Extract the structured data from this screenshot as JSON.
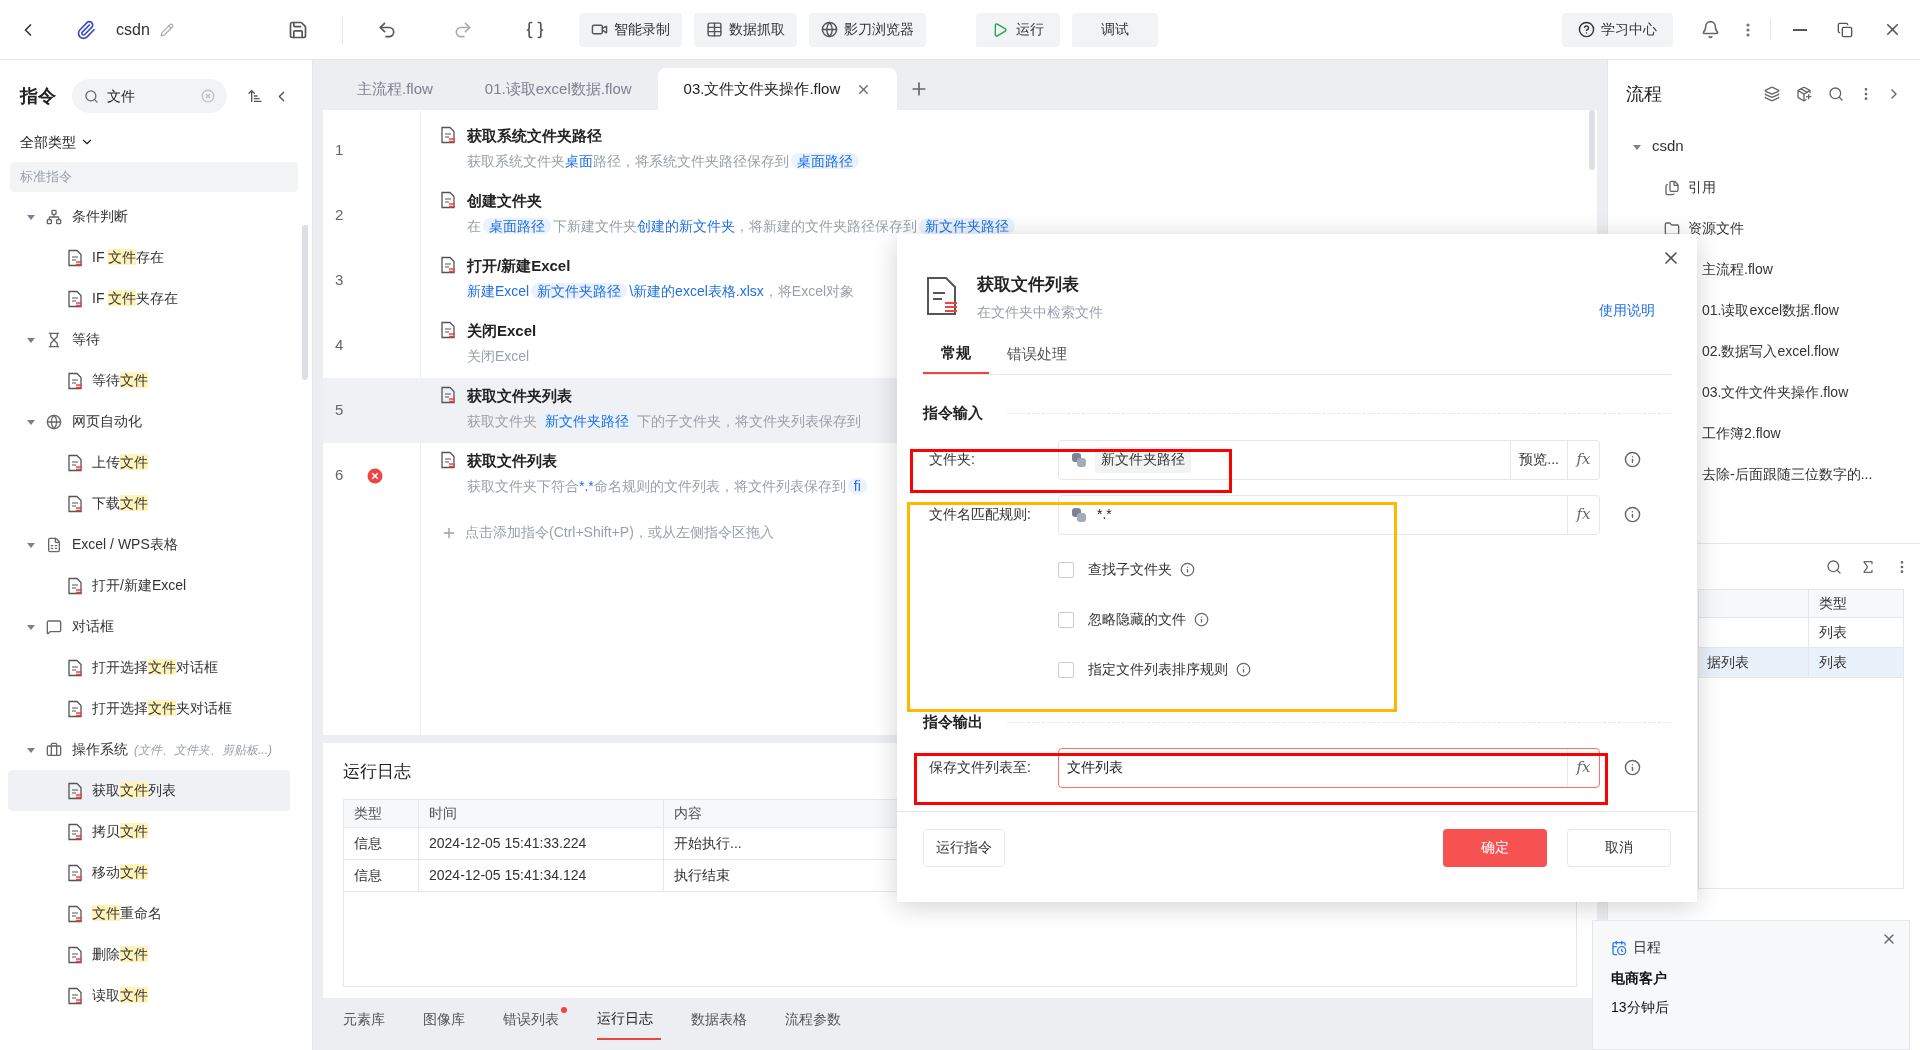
{
  "top_bar": {
    "project": "csdn",
    "tools": [
      {
        "label": "智能录制"
      },
      {
        "label": "数据抓取"
      },
      {
        "label": "影刀浏览器"
      }
    ],
    "run": "运行",
    "debug": "调试",
    "help": "学习中心"
  },
  "sidebar": {
    "title": "指令",
    "search": {
      "value": "文件"
    },
    "filter": "全部类型",
    "section": "标准指令",
    "categories": [
      {
        "label": "条件判断",
        "expanded": true,
        "children": [
          {
            "parts": [
              {
                "text": "IF "
              },
              {
                "text": "文件",
                "highlight": true
              },
              {
                "text": "存在"
              }
            ],
            "selected": false
          },
          {
            "parts": [
              {
                "text": "IF "
              },
              {
                "text": "文件",
                "highlight": true
              },
              {
                "text": "夹存在"
              }
            ],
            "selected": false
          }
        ]
      },
      {
        "label": "等待",
        "expanded": true,
        "children": [
          {
            "parts": [
              {
                "text": "等待"
              },
              {
                "text": "文件",
                "highlight": true
              }
            ],
            "selected": false
          }
        ]
      },
      {
        "label": "网页自动化",
        "expanded": true,
        "children": [
          {
            "parts": [
              {
                "text": "上传"
              },
              {
                "text": "文件",
                "highlight": true
              }
            ],
            "selected": false
          },
          {
            "parts": [
              {
                "text": "下载"
              },
              {
                "text": "文件",
                "highlight": true
              }
            ],
            "selected": false
          }
        ]
      },
      {
        "label": "Excel / WPS表格",
        "expanded": true,
        "children": [
          {
            "parts": [
              {
                "text": "打开/新建Excel"
              }
            ],
            "selected": false
          }
        ]
      },
      {
        "label": "对话框",
        "expanded": true,
        "children": [
          {
            "parts": [
              {
                "text": "打开选择"
              },
              {
                "text": "文件",
                "highlight": true
              },
              {
                "text": "对话框"
              }
            ],
            "selected": false
          },
          {
            "parts": [
              {
                "text": "打开选择"
              },
              {
                "text": "文件",
                "highlight": true
              },
              {
                "text": "夹对话框"
              }
            ],
            "selected": false
          }
        ]
      },
      {
        "label": "操作系统",
        "note": "(文件、文件夹、剪贴板...)",
        "expanded": true,
        "children": [
          {
            "parts": [
              {
                "text": "获取"
              },
              {
                "text": "文件",
                "highlight": true
              },
              {
                "text": "列表"
              }
            ],
            "selected": true
          },
          {
            "parts": [
              {
                "text": "拷贝"
              },
              {
                "text": "文件",
                "highlight": true
              }
            ],
            "selected": false
          },
          {
            "parts": [
              {
                "text": "移动"
              },
              {
                "text": "文件",
                "highlight": true
              }
            ],
            "selected": false
          },
          {
            "parts": [
              {
                "text": "文件",
                "highlight": true
              },
              {
                "text": "重命名"
              }
            ],
            "selected": false
          },
          {
            "parts": [
              {
                "text": "删除"
              },
              {
                "text": "文件",
                "highlight": true
              }
            ],
            "selected": false
          },
          {
            "parts": [
              {
                "text": "读取"
              },
              {
                "text": "文件",
                "highlight": true
              }
            ],
            "selected": false
          }
        ]
      }
    ]
  },
  "editor_tabs": [
    {
      "label": "主流程.flow",
      "selected": false
    },
    {
      "label": "01.读取excel数据.flow",
      "selected": false
    },
    {
      "label": "03.文件文件夹操作.flow",
      "selected": true
    }
  ],
  "steps": [
    {
      "number": "1",
      "title": "获取系统文件夹路径",
      "selected": false,
      "error": false,
      "desc": [
        {
          "text": "获取系统文件夹",
          "kind": "text"
        },
        {
          "text": "桌面",
          "kind": "link"
        },
        {
          "text": "路径，将系统文件夹路径保存到",
          "kind": "text"
        },
        {
          "text": "桌面路径",
          "kind": "chip"
        }
      ]
    },
    {
      "number": "2",
      "title": "创建文件夹",
      "selected": false,
      "error": false,
      "desc": [
        {
          "text": "在",
          "kind": "text"
        },
        {
          "text": "桌面路径",
          "kind": "chip"
        },
        {
          "text": "下新建文件夹",
          "kind": "text"
        },
        {
          "text": "创建的新文件夹",
          "kind": "link"
        },
        {
          "text": "，将新建的文件夹路径保存到",
          "kind": "text"
        },
        {
          "text": "新文件夹路径",
          "kind": "chip"
        }
      ]
    },
    {
      "number": "3",
      "title": "打开/新建Excel",
      "selected": false,
      "error": false,
      "desc": [
        {
          "text": "新建Excel",
          "kind": "link"
        },
        {
          "text": "新文件夹路径",
          "kind": "chip"
        },
        {
          "text": "\\新建的excel表格.xlsx",
          "kind": "link"
        },
        {
          "text": "，将Excel对象",
          "kind": "text"
        }
      ]
    },
    {
      "number": "4",
      "title": "关闭Excel",
      "selected": false,
      "error": false,
      "desc": [
        {
          "text": "关闭Excel",
          "kind": "text"
        }
      ]
    },
    {
      "number": "5",
      "title": "获取文件夹列表",
      "selected": true,
      "error": false,
      "desc": [
        {
          "text": "获取文件夹",
          "kind": "text"
        },
        {
          "text": "新文件夹路径",
          "kind": "chip"
        },
        {
          "text": "下的子文件夹，将文件夹列表保存到",
          "kind": "text"
        }
      ]
    },
    {
      "number": "6",
      "title": "获取文件列表",
      "selected": false,
      "error": true,
      "desc": [
        {
          "text": "获取文件夹下符合",
          "kind": "text"
        },
        {
          "text": "*.*",
          "kind": "link"
        },
        {
          "text": "命名规则的文件列表，将文件列表保存到",
          "kind": "text"
        },
        {
          "text": "fi",
          "kind": "chip"
        }
      ]
    }
  ],
  "add_hint": "点击添加指令(Ctrl+Shift+P)，或从左侧指令区拖入",
  "run_log": {
    "title": "运行日志",
    "columns": [
      "类型",
      "时间",
      "内容"
    ],
    "rows": [
      [
        "信息",
        "2024-12-05 15:41:33.224",
        "开始执行..."
      ],
      [
        "信息",
        "2024-12-05 15:41:34.124",
        "执行结束"
      ]
    ]
  },
  "bottom_tabs": [
    {
      "label": "元素库",
      "selected": false,
      "badge": false
    },
    {
      "label": "图像库",
      "selected": false,
      "badge": false
    },
    {
      "label": "错误列表",
      "selected": false,
      "badge": true
    },
    {
      "label": "运行日志",
      "selected": true,
      "badge": false
    },
    {
      "label": "数据表格",
      "selected": false,
      "badge": false
    },
    {
      "label": "流程参数",
      "selected": false,
      "badge": false
    }
  ],
  "flow_panel": {
    "title": "流程",
    "root": {
      "label": "csdn",
      "expanded": true,
      "children": [
        {
          "label": "引用"
        },
        {
          "label": "资源文件"
        }
      ]
    },
    "files": [
      "主流程.flow",
      "01.读取excel数据.flow",
      "02.数据写入excel.flow",
      "03.文件文件夹操作.flow",
      "工作簿2.flow",
      "去除-后面跟随三位数字的..."
    ],
    "variables": {
      "columns": [
        "类型"
      ],
      "rows": [
        {
          "name": "",
          "type": "列表",
          "selected": false
        },
        {
          "name": "据列表",
          "type": "列表",
          "selected": true
        }
      ]
    }
  },
  "dialog": {
    "title": "获取文件列表",
    "subtitle": "在文件夹中检索文件",
    "help_link": "使用说明",
    "tabs": [
      {
        "label": "常规",
        "selected": true
      },
      {
        "label": "错误处理",
        "selected": false
      }
    ],
    "input_section": "指令输入",
    "output_section": "指令输出",
    "folder": {
      "label": "文件夹:",
      "value": "新文件夹路径",
      "preview": "预览...",
      "fx": "fx"
    },
    "pattern": {
      "label": "文件名匹配规则:",
      "value": "*.*",
      "fx": "fx"
    },
    "options": [
      {
        "label": "查找子文件夹",
        "checked": false
      },
      {
        "label": "忽略隐藏的文件",
        "checked": false
      },
      {
        "label": "指定文件列表排序规则",
        "checked": false
      }
    ],
    "output": {
      "label": "保存文件列表至:",
      "value": "文件列表",
      "fx": "fx",
      "focused": true
    },
    "annotations": [
      {
        "color": "#ff0000"
      },
      {
        "color": "#ffb800"
      },
      {
        "color": "#ff0000"
      }
    ],
    "buttons": {
      "run": "运行指令",
      "ok": "确定",
      "cancel": "取消"
    }
  },
  "notification": {
    "app": "日程",
    "title": "电商客户",
    "time": "13分钟后"
  }
}
